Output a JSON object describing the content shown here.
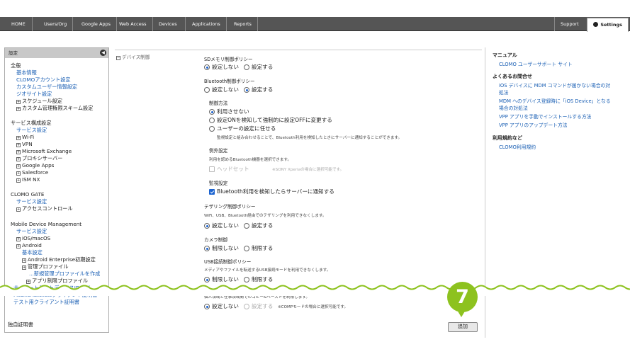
{
  "nav": {
    "tabs": [
      "HOME",
      "Users/Org",
      "Google Apps",
      "Web Access",
      "Devices",
      "Applications",
      "Reports"
    ],
    "support": "Support",
    "settings": "Settings"
  },
  "sidebar": {
    "header": "設定",
    "lines": [
      {
        "text": "全般",
        "cls": "black"
      },
      {
        "text": "基本情報",
        "cls": "link"
      },
      {
        "text": "CLOMOアカウント設定",
        "cls": "link"
      },
      {
        "text": "カスタムユーザー情報設定",
        "cls": "link"
      },
      {
        "text": "ジオサイト設定",
        "cls": "link"
      },
      {
        "text": "スケジュール設定",
        "cls": "black",
        "exp": true
      },
      {
        "text": "カスタム管理権限スキーム設定",
        "cls": "black",
        "exp": true
      },
      {
        "text": "サービス構成設定",
        "cls": "black"
      },
      {
        "text": "サービス設定",
        "cls": "link"
      },
      {
        "text": "Wi-Fi",
        "cls": "black",
        "exp": true
      },
      {
        "text": "VPN",
        "cls": "black",
        "exp": true
      },
      {
        "text": "Microsoft Exchange",
        "cls": "black",
        "exp": true
      },
      {
        "text": "プロキシサーバー",
        "cls": "black",
        "exp": true
      },
      {
        "text": "Google Apps",
        "cls": "black",
        "exp": true
      },
      {
        "text": "Salesforce",
        "cls": "black",
        "exp": true
      },
      {
        "text": "ISM NX",
        "cls": "black",
        "exp": true
      },
      {
        "text": "CLOMO GATE",
        "cls": "black"
      },
      {
        "text": "サービス設定",
        "cls": "link"
      },
      {
        "text": "アクセスコントロール",
        "cls": "black",
        "exp": true
      },
      {
        "text": "Mobile Device Management",
        "cls": "black"
      },
      {
        "text": "サービス設定",
        "cls": "link"
      },
      {
        "text": "iOS/macOS",
        "cls": "black",
        "exp": true
      },
      {
        "text": "Android",
        "cls": "black",
        "exp": true
      },
      {
        "text": "基本設定",
        "cls": "link"
      },
      {
        "text": "Android Enterprise初期設定",
        "cls": "black",
        "exp": true
      },
      {
        "text": "管理プロファイル",
        "cls": "black",
        "exp": true
      },
      {
        "text": "...新規管理プロファイルを作成",
        "cls": "link"
      },
      {
        "text": "アプリ制限プロファイル",
        "cls": "black",
        "exp": true
      },
      {
        "text": "サイバートラストデバイスID(個人...",
        "cls": "link"
      },
      {
        "text": "MobileAutotestクライアント証明書",
        "cls": "link"
      },
      {
        "text": "テスト用クライアント証明書",
        "cls": "link"
      },
      {
        "text": "独自証明書",
        "cls": "black"
      }
    ]
  },
  "main": {
    "section_title": "デバイス制御",
    "sd_title": "SDメモリ制御ポリシー",
    "no_setting": "設定しない",
    "do_setting": "設定する",
    "bt_title": "Bluetooth制御ポリシー",
    "control_method": "制御方法",
    "method_opts": [
      "利用させない",
      "設定ONを検知して強制的に設定OFFに変更する",
      "ユーザーの設定に任せる"
    ],
    "method_note": "監視設定と組み合わせることで、Bluetooth利用を検知したときにサーバーに通知することができます。",
    "exception_title": "例外設定",
    "exception_desc": "利用を認めるBluetooth機器を選択できます。",
    "headset": "ヘッドセット",
    "headset_note": "※SONY Xperiaの場合に選択可能です。",
    "monitor_title": "監視設定",
    "monitor_check": "Bluetooth利用を検知したらサーバーに通知する",
    "tether_title": "テザリング制御ポリシー",
    "tether_desc": "WiFi、USB、Bluetooth経由でのテザリングを利用できなくします。",
    "camera_title": "カメラ制御",
    "no_restrict": "制限しない",
    "restrict": "制限する",
    "usb_title": "USB接続制御ポリシー",
    "usb_desc": "メディアやファイルを転送するUSB接続モードを利用できなくします。",
    "copy_desc": "個人領域と仕事領域間でのコピー&ペーストを制限します。",
    "comp_note": "※COMPモードの場合に選択可能です。",
    "add_button": "追加"
  },
  "right": {
    "manual_title": "マニュアル",
    "manual_link": "CLOMO ユーザーサポート サイト",
    "faq_title": "よくあるお問合せ",
    "faq_links": [
      "iOS デバイスに MDM コマンドが届かない場合の対",
      "処法",
      "MDM へのデバイス登録時に「iOS Device」となる",
      "場合の対処法",
      "VPP アプリを手動でインストールする方法",
      "VPP アプリのアップデート方法"
    ],
    "terms_title": "利用規約など",
    "terms_link": "CLOMO利用規約"
  },
  "step_badge": "7"
}
